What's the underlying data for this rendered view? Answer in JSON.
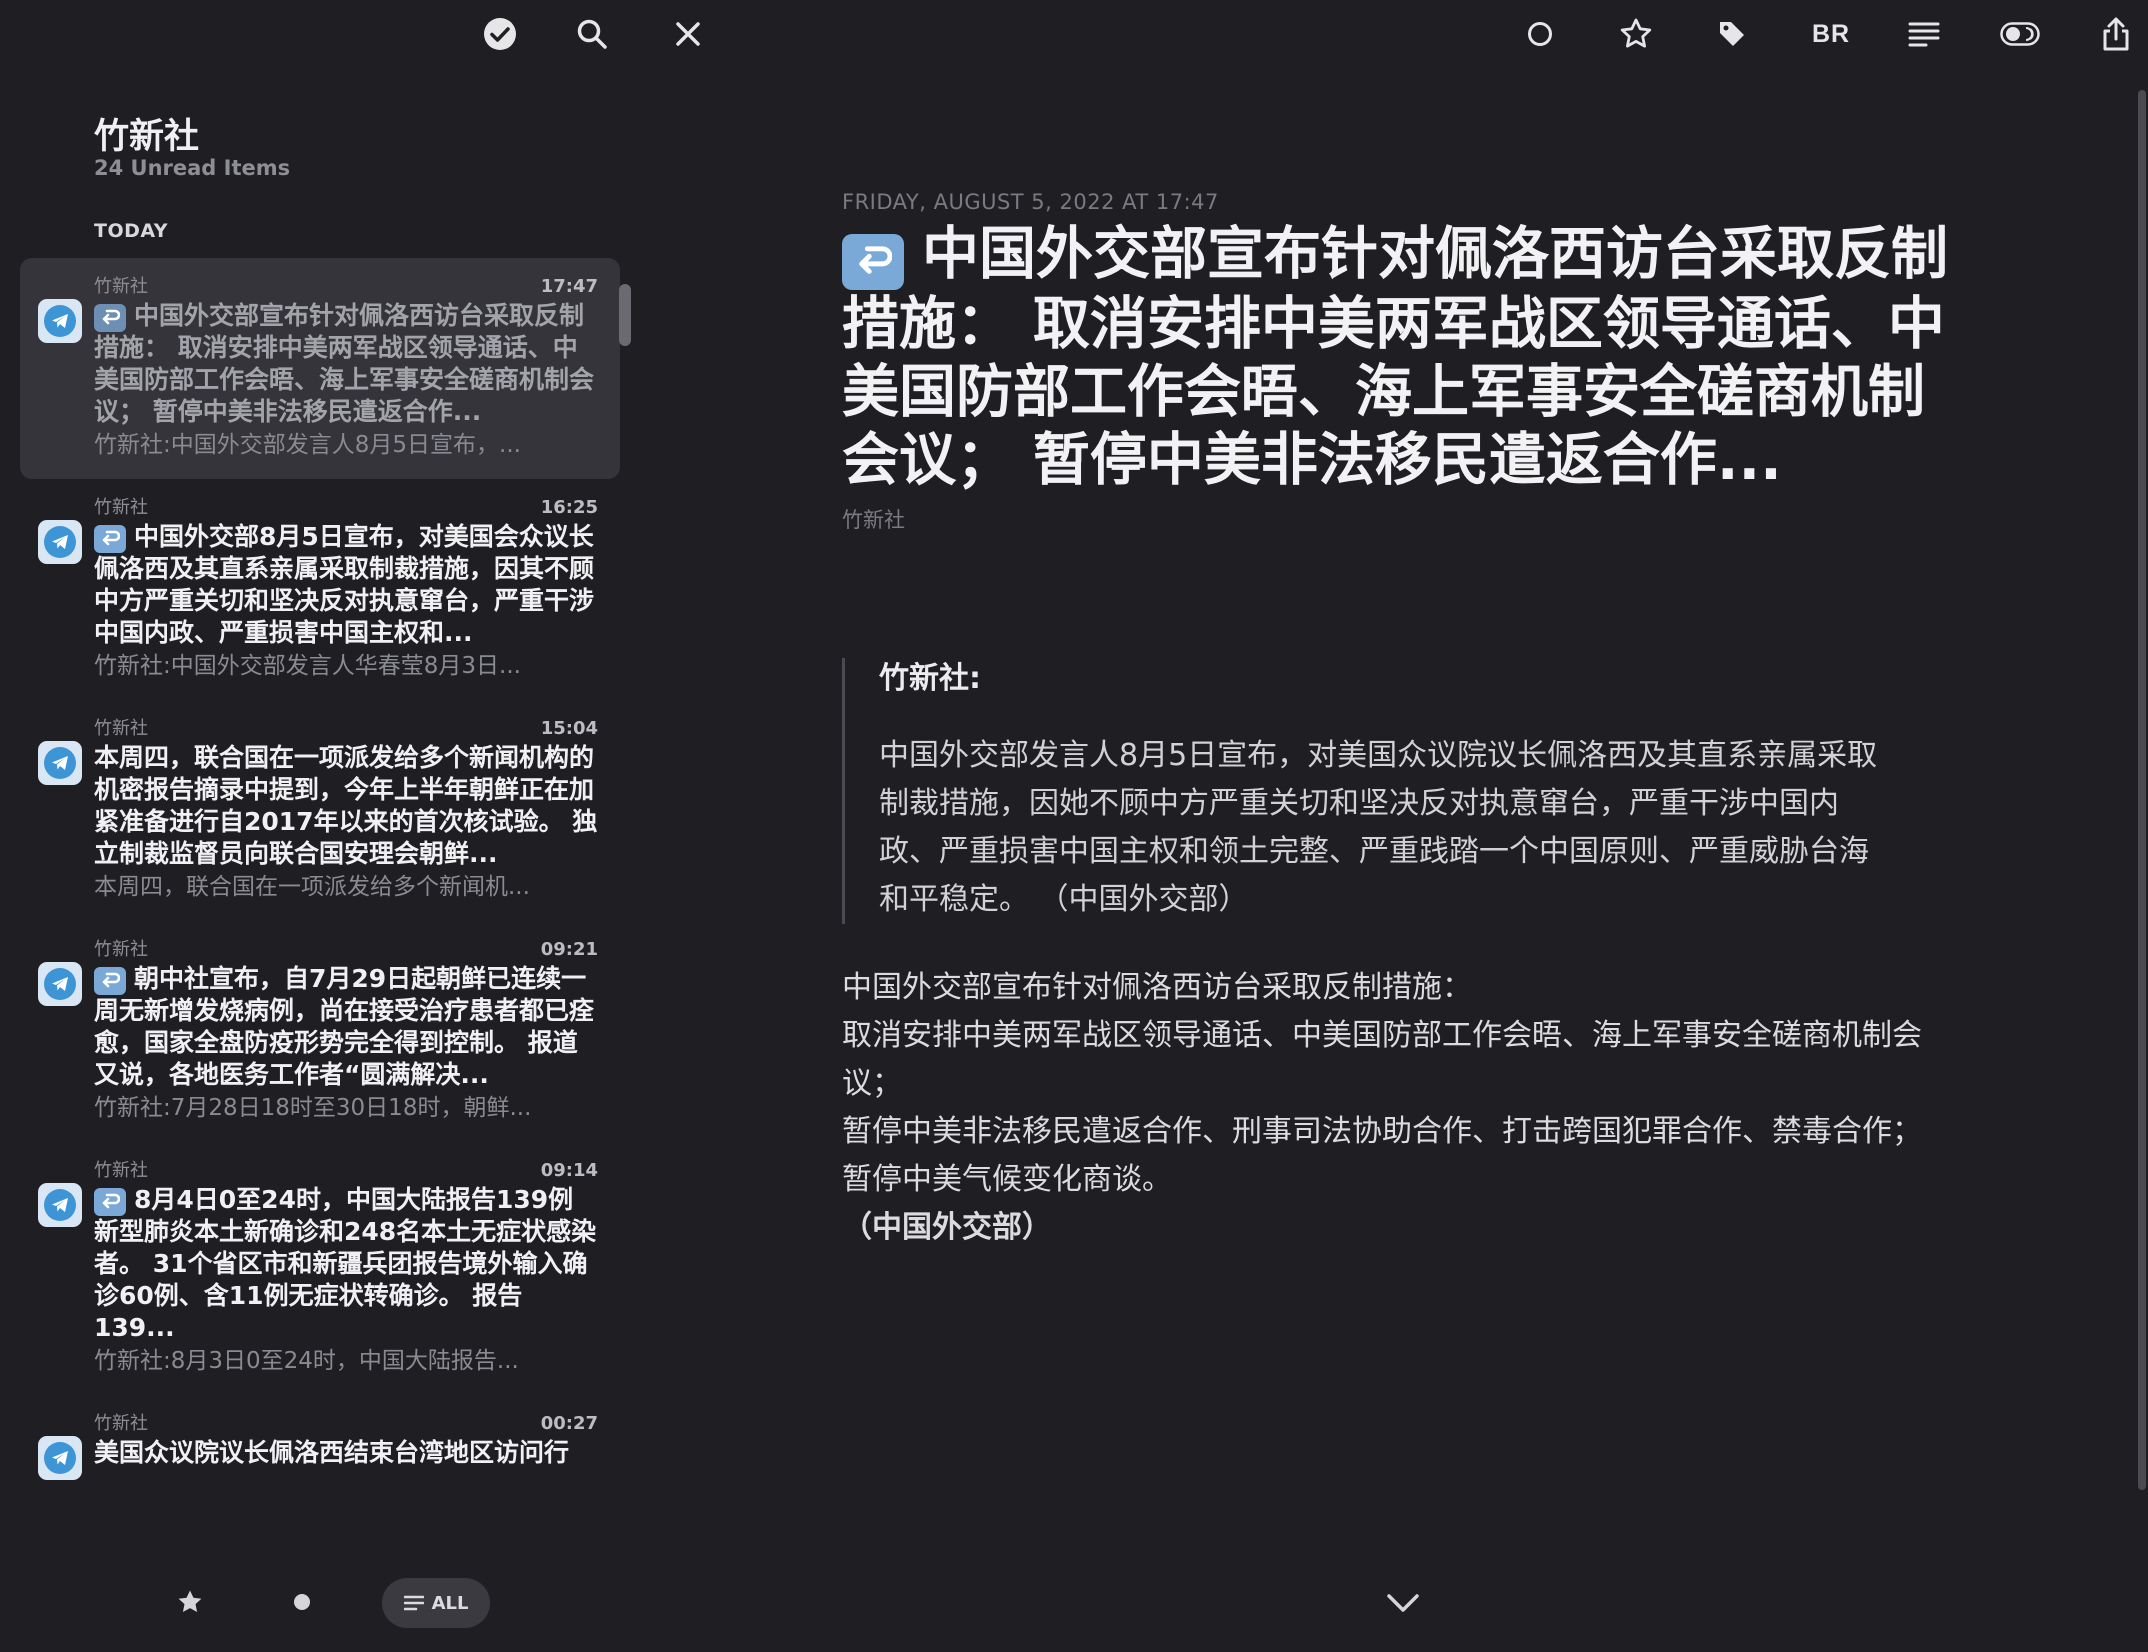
{
  "toolbar": {
    "typography_label": "BR"
  },
  "sidebar": {
    "feed_title": "竹新社",
    "unread": "24 Unread Items",
    "section": "TODAY",
    "items": [
      {
        "source": "竹新社",
        "time": "17:47",
        "reply": true,
        "title": "中国外交部宣布针对佩洛西访台采取反制措施： 取消安排中美两军战区领导通话、中美国防部工作会晤、海上军事安全磋商机制会议； 暂停中美非法移民遣返合作...",
        "snippet": "竹新社:中国外交部发言人8月5日宣布，..."
      },
      {
        "source": "竹新社",
        "time": "16:25",
        "reply": true,
        "title": "中国外交部8月5日宣布，对美国会众议长佩洛西及其直系亲属采取制裁措施，因其不顾中方严重关切和坚决反对执意窜台，严重干涉中国内政、严重损害中国主权和...",
        "snippet": "竹新社:中国外交部发言人华春莹8月3日..."
      },
      {
        "source": "竹新社",
        "time": "15:04",
        "reply": false,
        "title": "本周四，联合国在一项派发给多个新闻机构的机密报告摘录中提到，今年上半年朝鲜正在加紧准备进行自2017年以来的首次核试验。 独立制裁监督员向联合国安理会朝鲜...",
        "snippet": "本周四，联合国在一项派发给多个新闻机..."
      },
      {
        "source": "竹新社",
        "time": "09:21",
        "reply": true,
        "title": "朝中社宣布，自7月29日起朝鲜已连续一周无新增发烧病例，尚在接受治疗患者都已痊愈，国家全盘防疫形势完全得到控制。 报道又说，各地医务工作者“圆满解决...",
        "snippet": "竹新社:7月28日18时至30日18时，朝鲜..."
      },
      {
        "source": "竹新社",
        "time": "09:14",
        "reply": true,
        "title": "8月4日0至24时，中国大陆报告139例新型肺炎本土新确诊和248名本土无症状感染者。 31个省区市和新疆兵团报告境外输入确诊60例、含11例无症状转确诊。 报告139...",
        "snippet": "竹新社:8月3日0至24时，中国大陆报告..."
      },
      {
        "source": "竹新社",
        "time": "00:27",
        "reply": false,
        "title": "美国众议院议长佩洛西结束台湾地区访问行",
        "snippet": ""
      }
    ]
  },
  "bottombar": {
    "all_label": "ALL"
  },
  "article": {
    "date": "FRIDAY, AUGUST 5, 2022 AT 17:47",
    "title": "中国外交部宣布针对佩洛西访台采取反制措施： 取消安排中美两军战区领导通话、中美国防部工作会晤、海上军事安全磋商机制会议； 暂停中美非法移民遣返合作...",
    "source": "竹新社",
    "quote_head": "竹新社:",
    "quote_body": "中国外交部发言人8月5日宣布，对美国众议院议长佩洛西及其直系亲属采取制裁措施，因她不顾中方严重关切和坚决反对执意窜台，严重干涉中国内政、严重损害中国主权和领土完整、严重践踏一个中国原则、严重威胁台海和平稳定。 （中国外交部）",
    "body_lines": [
      "中国外交部宣布针对佩洛西访台采取反制措施：",
      "取消安排中美两军战区领导通话、中美国防部工作会晤、海上军事安全磋商机制会议；",
      "暂停中美非法移民遣返合作、刑事司法协助合作、打击跨国犯罪合作、禁毒合作；",
      "暂停中美气候变化商谈。",
      "（中国外交部）"
    ]
  },
  "colors": {
    "background": "#1f1f23",
    "selected_row": "#34343a",
    "accent_blue": "#3e95d6",
    "reply_badge": "#7aa9d8"
  }
}
